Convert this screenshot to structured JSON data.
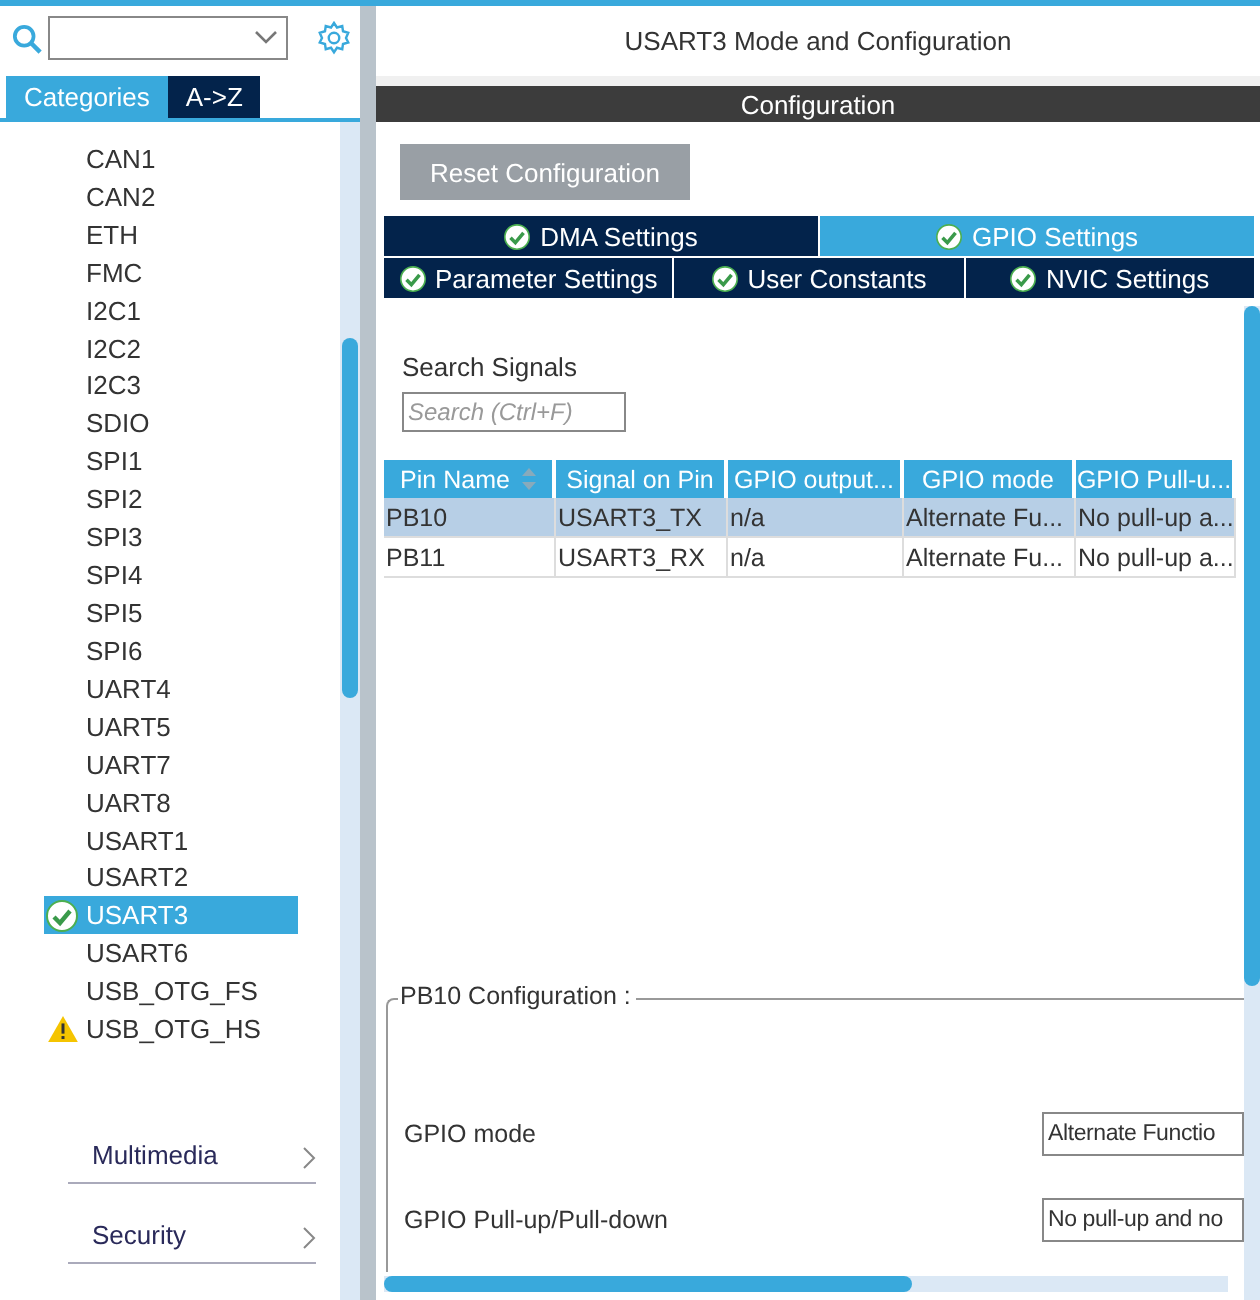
{
  "sidebar": {
    "tabs": [
      {
        "label": "Categories",
        "selected": true
      },
      {
        "label": "A->Z",
        "selected": false
      }
    ],
    "items": [
      {
        "label": "CAN1",
        "selected": false,
        "configured": false,
        "warning": false
      },
      {
        "label": "CAN2",
        "selected": false,
        "configured": false,
        "warning": false
      },
      {
        "label": "ETH",
        "selected": false,
        "configured": false,
        "warning": false
      },
      {
        "label": "FMC",
        "selected": false,
        "configured": false,
        "warning": false
      },
      {
        "label": "I2C1",
        "selected": false,
        "configured": false,
        "warning": false
      },
      {
        "label": "I2C2",
        "selected": false,
        "configured": false,
        "warning": false
      },
      {
        "label": "I2C3",
        "selected": false,
        "configured": false,
        "warning": false
      },
      {
        "label": "SDIO",
        "selected": false,
        "configured": false,
        "warning": false
      },
      {
        "label": "SPI1",
        "selected": false,
        "configured": false,
        "warning": false
      },
      {
        "label": "SPI2",
        "selected": false,
        "configured": false,
        "warning": false
      },
      {
        "label": "SPI3",
        "selected": false,
        "configured": false,
        "warning": false
      },
      {
        "label": "SPI4",
        "selected": false,
        "configured": false,
        "warning": false
      },
      {
        "label": "SPI5",
        "selected": false,
        "configured": false,
        "warning": false
      },
      {
        "label": "SPI6",
        "selected": false,
        "configured": false,
        "warning": false
      },
      {
        "label": "UART4",
        "selected": false,
        "configured": false,
        "warning": false
      },
      {
        "label": "UART5",
        "selected": false,
        "configured": false,
        "warning": false
      },
      {
        "label": "UART7",
        "selected": false,
        "configured": false,
        "warning": false
      },
      {
        "label": "UART8",
        "selected": false,
        "configured": false,
        "warning": false
      },
      {
        "label": "USART1",
        "selected": false,
        "configured": false,
        "warning": false
      },
      {
        "label": "USART2",
        "selected": false,
        "configured": false,
        "warning": false
      },
      {
        "label": "USART3",
        "selected": true,
        "configured": true,
        "warning": false
      },
      {
        "label": "USART6",
        "selected": false,
        "configured": false,
        "warning": false
      },
      {
        "label": "USB_OTG_FS",
        "selected": false,
        "configured": false,
        "warning": false
      },
      {
        "label": "USB_OTG_HS",
        "selected": false,
        "configured": false,
        "warning": true
      }
    ],
    "categories": [
      {
        "label": "Multimedia"
      },
      {
        "label": "Security"
      }
    ]
  },
  "main": {
    "title": "USART3 Mode and Configuration",
    "section": "Configuration",
    "reset_button": "Reset Configuration",
    "tab_rows": [
      [
        {
          "label": "DMA Settings",
          "selected": false,
          "configured": true
        },
        {
          "label": "GPIO Settings",
          "selected": true,
          "configured": true
        }
      ],
      [
        {
          "label": "Parameter Settings",
          "selected": false,
          "configured": true
        },
        {
          "label": "User Constants",
          "selected": false,
          "configured": true
        },
        {
          "label": "NVIC Settings",
          "selected": false,
          "configured": true
        }
      ]
    ],
    "search_label": "Search Signals",
    "search": {
      "placeholder": "Search (Ctrl+F)"
    },
    "table": {
      "columns": [
        {
          "label": "Pin Name",
          "sorted": true
        },
        {
          "label": "Signal on Pin",
          "sorted": false
        },
        {
          "label": "GPIO output...",
          "sorted": false
        },
        {
          "label": "GPIO mode",
          "sorted": false
        },
        {
          "label": "GPIO Pull-u...",
          "sorted": false
        }
      ],
      "rows": [
        {
          "selected": true,
          "cells": [
            "PB10",
            "USART3_TX",
            "n/a",
            "Alternate Fu...",
            "No pull-up a..."
          ]
        },
        {
          "selected": false,
          "cells": [
            "PB11",
            "USART3_RX",
            "n/a",
            "Alternate Fu...",
            "No pull-up a..."
          ]
        }
      ]
    },
    "config": {
      "title": "PB10 Configuration :",
      "fields": [
        {
          "label": "GPIO mode",
          "value": "Alternate Functio"
        },
        {
          "label": "GPIO Pull-up/Pull-down",
          "value": "No pull-up and no"
        }
      ]
    }
  }
}
